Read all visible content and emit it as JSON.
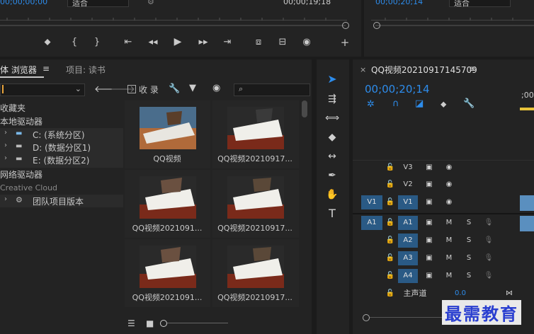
{
  "top_monitor": {
    "left_timecode": "00;00;00;00",
    "left_zoom": "适合",
    "right_timecode": "00;00;20;14",
    "right_zoom": "适合",
    "source_timecode": "00;00;19;18"
  },
  "media_browser": {
    "tab_label": "体 浏览器",
    "tab_menu": "≡",
    "project_tab": "项目: 读书",
    "favorites_checkbox": "收 录",
    "tree": [
      {
        "label": "收藏夹",
        "indent": 0
      },
      {
        "label": "本地驱动器",
        "indent": 0
      },
      {
        "label": "C: (系统分区)",
        "indent": 1
      },
      {
        "label": "D: (数据分区1)",
        "indent": 1
      },
      {
        "label": "E: (数据分区2)",
        "indent": 1
      },
      {
        "label": "网络驱动器",
        "indent": 0
      },
      {
        "label": "Creative Cloud",
        "indent": 0
      },
      {
        "label": "团队项目版本",
        "indent": 1
      }
    ],
    "thumbnails": [
      {
        "label": "QQ视频"
      },
      {
        "label": "QQ视频20210917..."
      },
      {
        "label": "QQ视频2021091..."
      },
      {
        "label": "QQ视频20210917..."
      },
      {
        "label": "QQ视频2021091..."
      },
      {
        "label": "QQ视频20210917..."
      }
    ]
  },
  "timeline": {
    "sequence_name": "QQ视频20210917145709",
    "timecode": "00;00;20;14",
    "ruler_label": ";00;",
    "video_tracks": [
      "V3",
      "V2",
      "V1"
    ],
    "audio_tracks": [
      "A1",
      "A2",
      "A3",
      "A4"
    ],
    "source_v": "V1",
    "source_a": "A1",
    "master_label": "主声道",
    "master_value": "0.0",
    "mute_label": "M",
    "solo_label": "S"
  },
  "watermark": "最需教育",
  "colors": {
    "accent": "#2d8ceb",
    "panel_bg": "#232323",
    "track_blue": "#2a5a85"
  }
}
